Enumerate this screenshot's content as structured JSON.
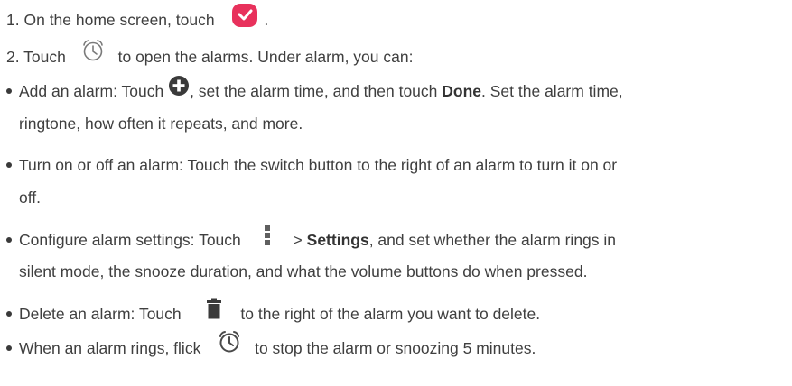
{
  "steps": [
    {
      "num": "1.",
      "before": "On the home screen, touch",
      "after": "."
    },
    {
      "num": "2.",
      "before": "Touch",
      "after": "to open the alarms. Under alarm, you can:"
    }
  ],
  "bullets": {
    "add": {
      "before": "Add an alarm: Touch",
      "mid": ", set the alarm time, and then touch",
      "bold": "Done",
      "after": ". Set the alarm time,",
      "cont": "ringtone, how often it repeats, and more."
    },
    "toggle": {
      "text": "Turn on or off an alarm: Touch the switch button to the right of an alarm to turn it on or",
      "cont": "off."
    },
    "settings": {
      "before": "Configure alarm settings: Touch",
      "gt": ">",
      "bold": "Settings",
      "after": ", and set whether the alarm rings in",
      "cont": "silent mode, the snooze duration, and what the volume buttons do when pressed."
    },
    "delete": {
      "before": "Delete an alarm: Touch",
      "after": "to the right of the alarm you want to delete."
    },
    "rings": {
      "before": "When an alarm rings, flick",
      "after": "to stop the alarm or snoozing 5 minutes."
    }
  },
  "icons": {
    "clock_app": "clock-app-icon",
    "alarm": "alarm-clock-icon",
    "add": "add-circle-icon",
    "menu": "menu-icon",
    "trash": "trash-icon",
    "alarm_ring": "alarm-clock-icon"
  },
  "colors": {
    "clock_app_bg": "#e8315c",
    "icon_gray": "#6a6a6a",
    "icon_dark": "#3a3a3a",
    "text": "#3f3f3f"
  }
}
